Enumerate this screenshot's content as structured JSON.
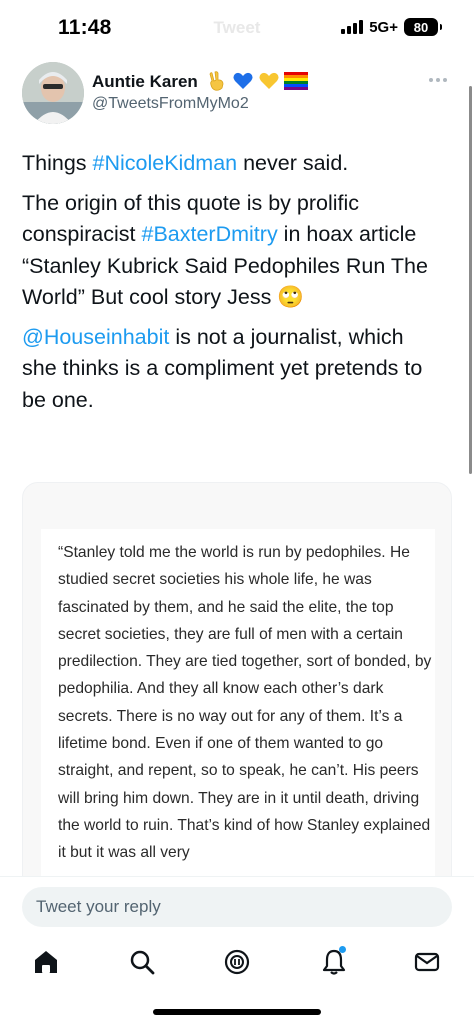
{
  "status_bar": {
    "time": "11:48",
    "ghost_title": "Tweet",
    "network": "5G+",
    "battery": "80"
  },
  "author": {
    "display_name": "Auntie Karen",
    "emojis": [
      "victory-hand",
      "blue-heart",
      "yellow-heart",
      "rainbow-flag"
    ],
    "handle": "@TweetsFromMyMo2"
  },
  "tweet": {
    "paragraphs": [
      [
        {
          "text": "Things "
        },
        {
          "text": "#NicoleKidman",
          "link": true
        },
        {
          "text": " never said."
        }
      ],
      [
        {
          "text": "The origin of this quote is by prolific conspiracist "
        },
        {
          "text": "#BaxterDmitry",
          "link": true
        },
        {
          "text": " in hoax article “Stanley Kubrick Said Pedophiles Run The World” But cool story Jess "
        },
        {
          "text": "🙄"
        }
      ],
      [
        {
          "text": "@Houseinhabit",
          "link": true
        },
        {
          "text": " is not a journalist, which she thinks is a compliment yet pretends to be one."
        }
      ]
    ]
  },
  "quote_card": {
    "text": "“Stanley told me the world is run by pedophiles. He studied secret societies his whole life, he was fascinated by them, and he said the elite, the top secret societies, they are full of men with a certain predilection. They are tied together, sort of bonded, by pedophilia. And they all know each other’s dark secrets. There is no way out for any of them. It’s a lifetime bond. Even if one of them wanted to go straight, and repent, so to speak, he can’t. His peers will bring him down. They are in it until death, driving the world to ruin. That’s kind of how Stanley explained it but it was all very"
  },
  "reply": {
    "placeholder": "Tweet your reply"
  },
  "tab_bar": {
    "tabs": [
      "home-icon",
      "search-icon",
      "spaces-icon",
      "notifications-icon",
      "messages-icon"
    ],
    "notification_dot_color": "#1d9bf0"
  },
  "colors": {
    "link": "#1d9bf0",
    "text": "#0f1419",
    "secondary": "#536471"
  }
}
